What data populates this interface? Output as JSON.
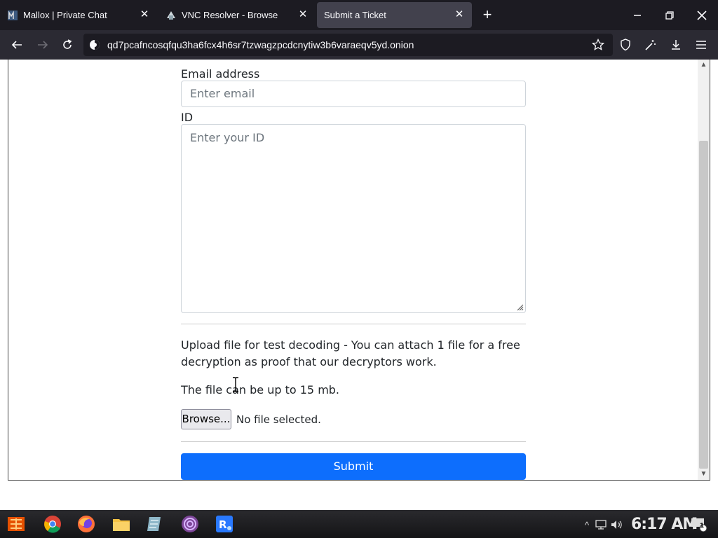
{
  "browser": {
    "tabs": [
      {
        "label": "Mallox | Private Chat",
        "icon": "mallox-favicon-icon"
      },
      {
        "label": "VNC Resolver - Browse",
        "icon": "vnc-favicon-icon"
      },
      {
        "label": "Submit a Ticket",
        "icon": "none",
        "active": true
      }
    ],
    "url": "qd7pcafncosqfqu3ha6fcx4h6sr7tzwagzpcdcnytiw3b6varaeqv5yd.onion"
  },
  "form": {
    "email_label": "Email address",
    "email_placeholder": "Enter email",
    "id_label": "ID",
    "id_placeholder": "Enter your ID",
    "upload_text": "Upload file for test decoding - You can attach 1 file for a free decryption as proof that our decryptors work.",
    "size_text": "The file can be up to 15 mb.",
    "browse_label": "Browse...",
    "no_file_text": "No file selected.",
    "submit_label": "Submit"
  },
  "taskbar": {
    "clock": "6:17 AM",
    "apps": [
      "chrome-icon",
      "firefox-icon",
      "folder-icon",
      "notepad-icon",
      "tor-browser-icon",
      "rdp-icon"
    ],
    "notification_count": "1"
  }
}
